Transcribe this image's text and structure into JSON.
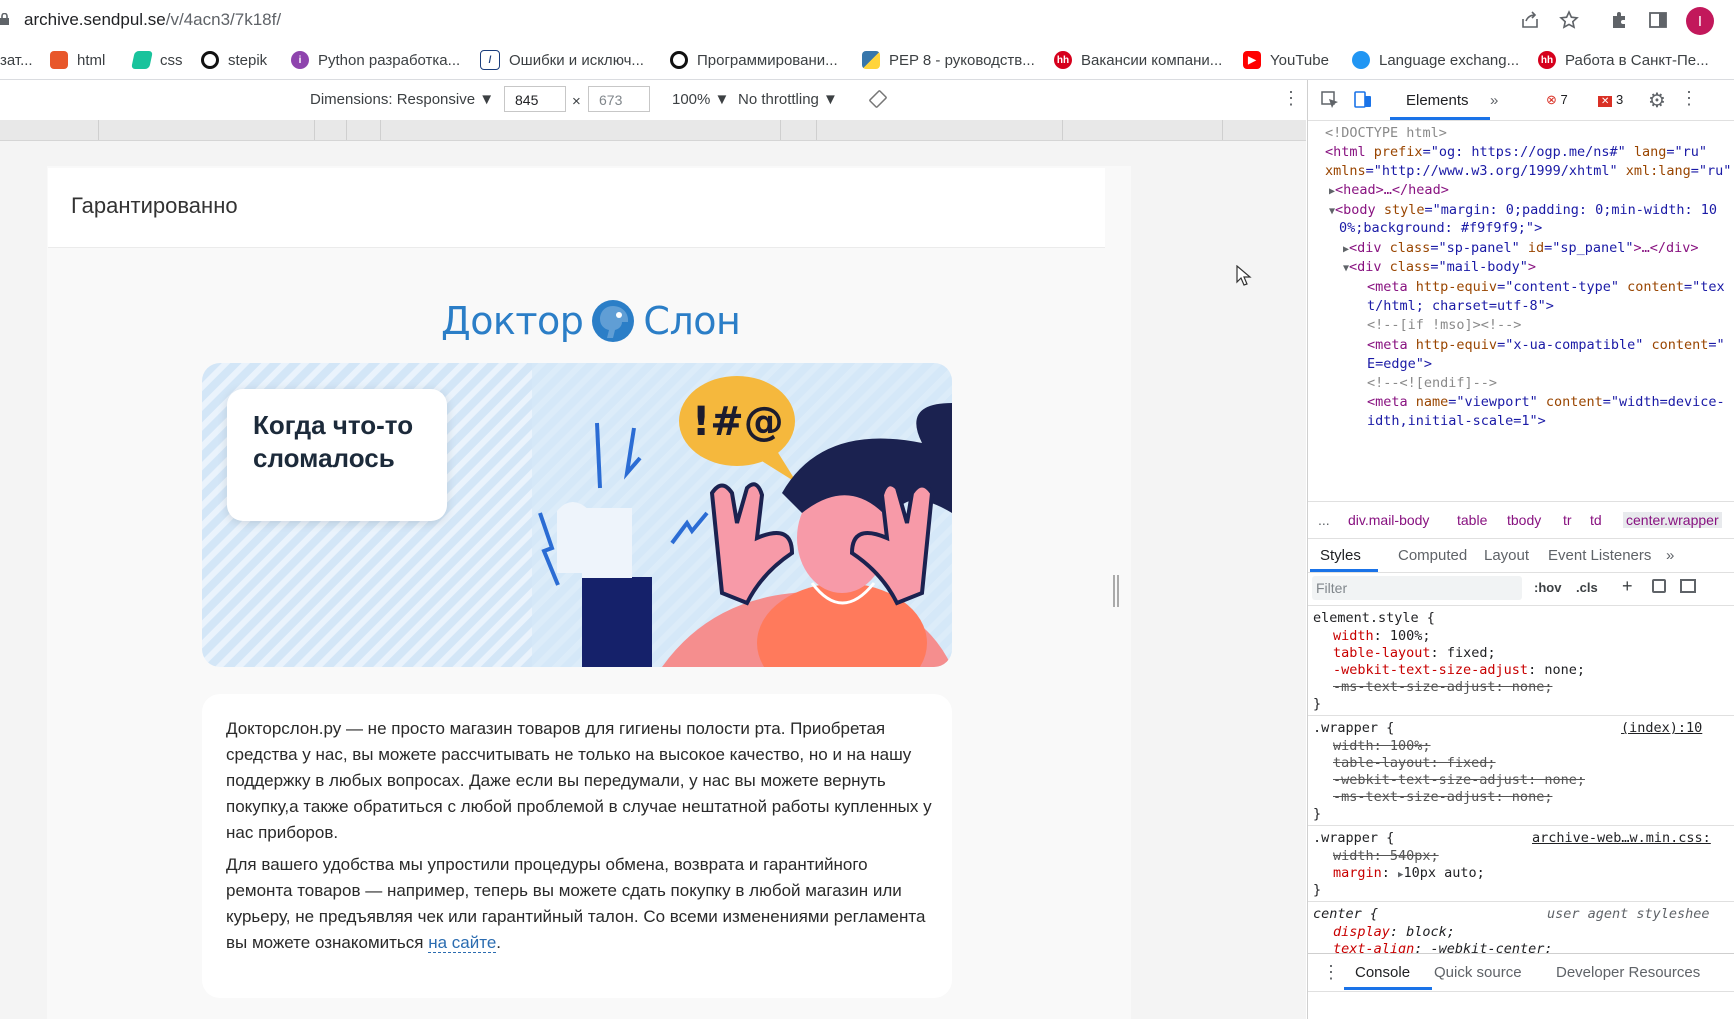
{
  "browser": {
    "url_host": "archive.sendpul.se",
    "url_path": "/v/4acn3/7k18f/",
    "avatar_letter": "I"
  },
  "bookmarks": [
    {
      "label": "зат...",
      "icon": "none"
    },
    {
      "label": "html",
      "icon": "html-icon"
    },
    {
      "label": "css",
      "icon": "css-icon"
    },
    {
      "label": "stepik",
      "icon": "stepik-icon"
    },
    {
      "label": "Python разработка...",
      "icon": "python-course-icon"
    },
    {
      "label": "Ошибки и исключ...",
      "icon": "doc-icon"
    },
    {
      "label": "Программировани...",
      "icon": "stepik-icon"
    },
    {
      "label": "PEP 8 - руководств...",
      "icon": "python-icon"
    },
    {
      "label": "Вакансии компани...",
      "icon": "hh-icon"
    },
    {
      "label": "YouTube",
      "icon": "youtube-icon"
    },
    {
      "label": "Language exchang...",
      "icon": "language-icon"
    },
    {
      "label": "Работа в Санкт-Пе...",
      "icon": "hh-icon"
    }
  ],
  "device_toolbar": {
    "dimensions": "Dimensions: Responsive",
    "width": "845",
    "height": "673",
    "times": "×",
    "zoom": "100%",
    "throttling": "No throttling"
  },
  "email": {
    "panel_title": "Гарантированно",
    "logo_left": "Доктор",
    "logo_right": "Слон",
    "hero_text": "Когда что-то сломалось",
    "hero_symbols": "!#@",
    "paragraph1": "Докторслон.ру — не просто магазин товаров для гигиены полости рта. Приобретая средства у нас, вы можете рассчитывать не только на высокое качество, но и на нашу поддержку в любых вопросах. Даже если вы передумали, у нас вы можете вернуть покупку,а также обратиться с любой проблемой в случае нештатной работы купленных у нас приборов.",
    "paragraph2": "Для вашего удобства мы упростили процедуры обмена, возврата и гарантийного ремонта товаров — например, теперь вы можете сдать покупку в любой магазин или курьеру, не предъявляя чек или гарантийный талон. Со всеми изменениями регламента вы можете ознакомиться",
    "paragraph2_link": "на сайте",
    "paragraph2_end": "."
  },
  "devtools": {
    "tab_elements": "Elements",
    "errors": "7",
    "warnings": "3",
    "code": {
      "l1": "<!DOCTYPE html>",
      "l2a": "<html ",
      "l2b": "prefix",
      "l2c": "=\"og: https://ogp.me/ns#\" ",
      "l2d": "lang",
      "l2e": "=\"ru\"",
      "l3a": "xmlns",
      "l3b": "=\"http://www.w3.org/1999/xhtml\" ",
      "l3c": "xml:lang",
      "l3d": "=\"ru\"",
      "l4": "<head>…</head>",
      "l5a": "<body ",
      "l5b": "style",
      "l5c": "=\"margin: 0;padding: 0;min-width: 10",
      "l6": "0%;background: #f9f9f9;\">",
      "l7a": "<div ",
      "l7b": "class",
      "l7c": "=\"sp-panel\" ",
      "l7d": "id",
      "l7e": "=\"sp_panel\"",
      "l7f": ">…</div>",
      "l8a": "<div ",
      "l8b": "class",
      "l8c": "=\"mail-body\"",
      "l8d": ">",
      "l9a": "<meta ",
      "l9b": "http-equiv",
      "l9c": "=\"content-type\" ",
      "l9d": "content",
      "l9e": "=\"tex",
      "l10": "t/html; charset=utf-8\">",
      "l11": "<!--[if !mso]><!-->",
      "l12a": "<meta ",
      "l12b": "http-equiv",
      "l12c": "=\"x-ua-compatible\" ",
      "l12d": "content",
      "l12e": "=\"",
      "l13": "E=edge\">",
      "l14": "<!--<![endif]-->",
      "l15a": "<meta ",
      "l15b": "name",
      "l15c": "=\"viewport\" ",
      "l15d": "content",
      "l15e": "=\"width=device-",
      "l16": "idth,initial-scale=1\">"
    },
    "breadcrumbs": [
      "...",
      "div.mail-body",
      "table",
      "tbody",
      "tr",
      "td",
      "center.wrapper"
    ],
    "style_tabs": [
      "Styles",
      "Computed",
      "Layout",
      "Event Listeners"
    ],
    "filter_placeholder": "Filter",
    "hov": ":hov",
    "cls": ".cls",
    "rules": {
      "r1_sel": "element.style {",
      "r1_p1": "width",
      "r1_v1": "100%;",
      "r1_p2": "table-layout",
      "r1_v2": "fixed;",
      "r1_p3": "-webkit-text-size-adjust",
      "r1_v3": "none;",
      "r1_p4": "-ms-text-size-adjust: none;",
      "close": "}",
      "r2_sel": ".wrapper {",
      "r2_src": "(index):10",
      "r2_p1": "width: 100%;",
      "r2_p2": "table-layout: fixed;",
      "r2_p3": "-webkit-text-size-adjust: none;",
      "r2_p4": "-ms-text-size-adjust: none;",
      "r3_sel": ".wrapper {",
      "r3_src": "archive-web…w.min.css:",
      "r3_p1": "width: 540px;",
      "r3_p2": "margin",
      "r3_v2": "10px auto;",
      "r4_sel": "center {",
      "r4_src": "user agent styleshee",
      "r4_p1": "display",
      "r4_v1": "block;",
      "r4_p2": "text-align",
      "r4_v2": "-webkit-center;"
    },
    "console_tabs": [
      "Console",
      "Quick source",
      "Developer Resources"
    ]
  }
}
